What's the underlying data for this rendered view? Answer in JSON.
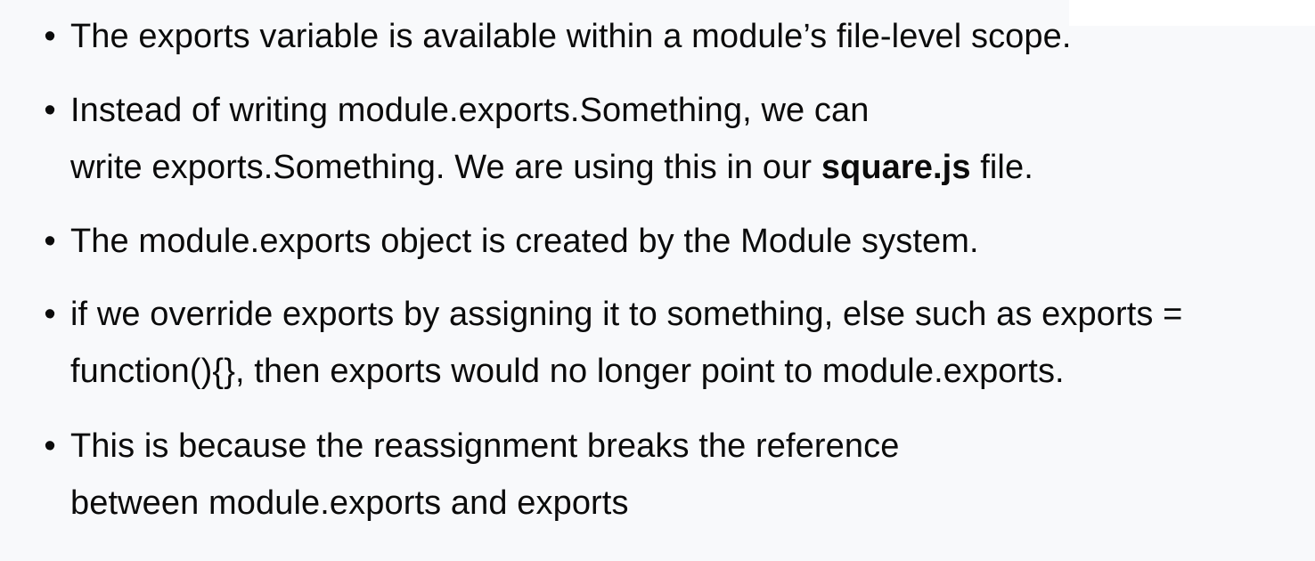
{
  "slide": {
    "bullets": [
      {
        "lines": [
          "The exports variable is available within a module’s file-level scope."
        ]
      },
      {
        "lines": [
          "Instead of writing module.exports.Something, we can",
          "write exports.Something. We are using this in our "
        ],
        "emphasis": "square.js",
        "suffix": " file."
      },
      {
        "lines": [
          "The module.exports object is created by the Module system."
        ]
      },
      {
        "lines": [
          "if we override exports by assigning it to something, else such as exports =",
          "function(){}, then exports would no longer point to module.exports."
        ]
      },
      {
        "lines": [
          "This is because the reassignment breaks the reference",
          "between module.exports and exports"
        ]
      }
    ],
    "bullet_symbol": "•"
  },
  "colors": {
    "background": "#f8f9fb",
    "text": "#0b0b0b"
  }
}
